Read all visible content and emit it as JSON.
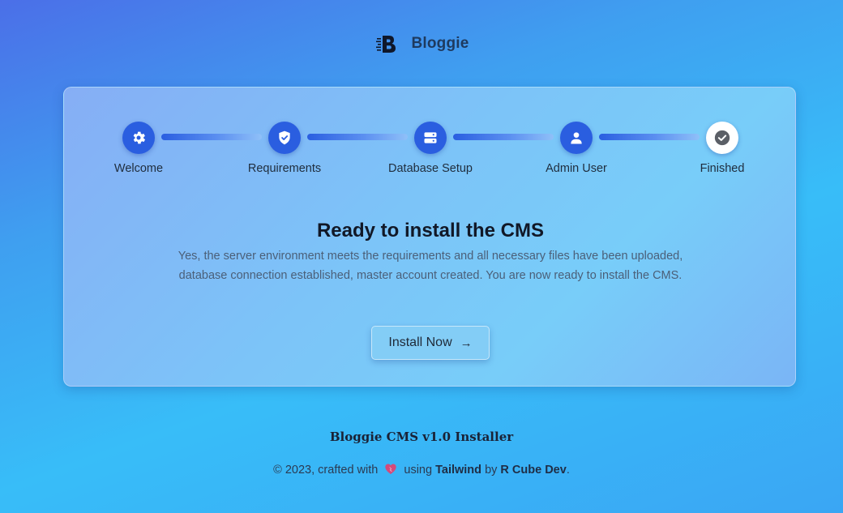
{
  "brand": {
    "name": "Bloggie",
    "icon": "bloggie-logo-icon"
  },
  "steps": [
    {
      "label": "Welcome",
      "icon": "gear-icon"
    },
    {
      "label": "Requirements",
      "icon": "shield-check-icon"
    },
    {
      "label": "Database Setup",
      "icon": "database-server-icon"
    },
    {
      "label": "Admin User",
      "icon": "user-icon"
    },
    {
      "label": "Finished",
      "icon": "check-circle-icon"
    }
  ],
  "main": {
    "title": "Ready to install the CMS",
    "description_line1": "Yes, the server environment meets the requirements and all necessary files have been uploaded,",
    "description_line2": "database connection established, master account created. You are now ready to install the CMS.",
    "install_label": "Install Now",
    "install_arrow": "→"
  },
  "footer": {
    "title": "Bloggie CMS v1.0 Installer",
    "prefix": "© 2023, crafted with",
    "using": "using",
    "tech": "Tailwind",
    "by": "by",
    "author": "R Cube Dev",
    "suffix": "."
  },
  "colors": {
    "accent": "#2a5ee0",
    "heart": "#d44a7a"
  }
}
